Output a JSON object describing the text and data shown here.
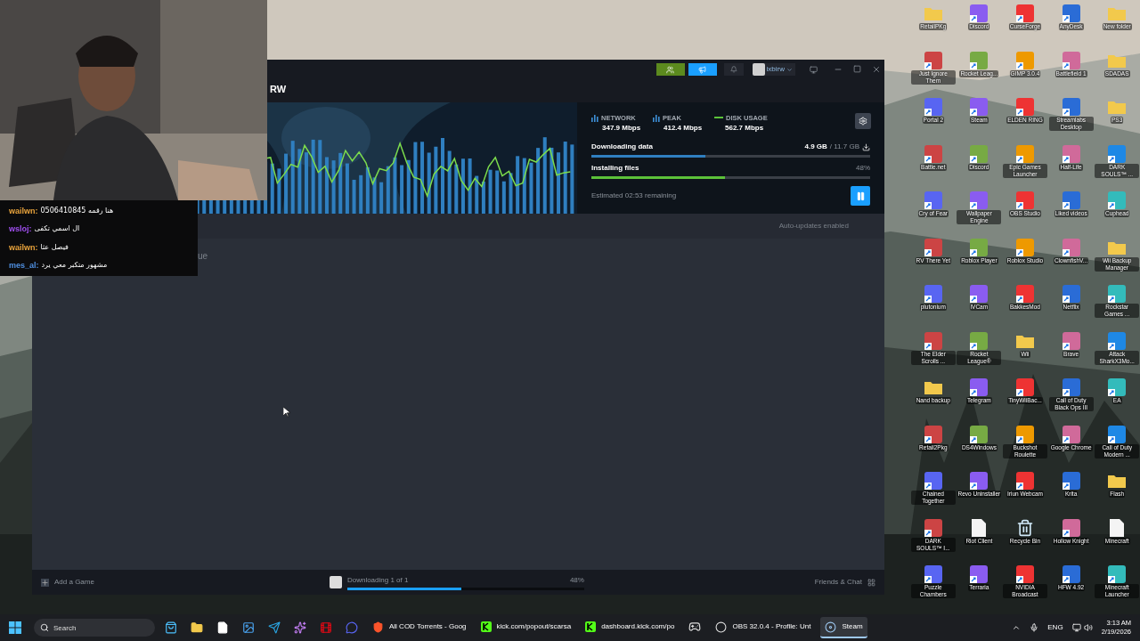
{
  "chat_overlay": {
    "messages": [
      {
        "user": "wailwn:",
        "color": "#e8a33c",
        "text": "هنا رقمه 0506410845"
      },
      {
        "user": "wsloj:",
        "color": "#a04ff0",
        "text": "ال اسمي تكفى"
      },
      {
        "user": "wailwn:",
        "color": "#e8a33c",
        "text": "فيصل عثا"
      },
      {
        "user": "mes_al:",
        "color": "#4f8fe0",
        "text": "مشهور متكبر معي يرد"
      }
    ]
  },
  "steam": {
    "title": "RW",
    "account": "ixbirw",
    "stats": [
      {
        "kind": "bars",
        "label": "NETWORK",
        "value": "347.9 Mbps"
      },
      {
        "kind": "bars",
        "label": "PEAK",
        "value": "412.4 Mbps"
      },
      {
        "kind": "line",
        "label": "DISK USAGE",
        "value": "562.7 Mbps"
      }
    ],
    "downloading": {
      "label": "Downloading data",
      "done": "4.9 GB",
      "total": "/ 11.7 GB",
      "level": 0.41
    },
    "installing": {
      "label": "Installing files",
      "percent": "48%",
      "level": 0.48
    },
    "estimate": "Estimated 02:53 remaining",
    "auto_updates": "Auto-updates enabled",
    "partial_text": "ue",
    "footer": {
      "add_game": "Add a Game",
      "download_status": "Downloading 1 of 1",
      "download_percent": "48%",
      "level": 0.48,
      "friends": "Friends & Chat"
    }
  },
  "desktop_icons": [
    {
      "label": "RetailPKg",
      "kind": "folder"
    },
    {
      "label": "Discord",
      "kind": "app"
    },
    {
      "label": "CurseForge",
      "kind": "app"
    },
    {
      "label": "AnyDesk",
      "kind": "app"
    },
    {
      "label": "New folder",
      "kind": "folder"
    },
    {
      "label": "Just Ignore Them",
      "kind": "app"
    },
    {
      "label": "Rocket Leag...",
      "kind": "app"
    },
    {
      "label": "GIMP 3.0.4",
      "kind": "app"
    },
    {
      "label": "Battlefield 1",
      "kind": "app"
    },
    {
      "label": "SDADAS",
      "kind": "folder"
    },
    {
      "label": "Portal 2",
      "kind": "app"
    },
    {
      "label": "Steam",
      "kind": "app"
    },
    {
      "label": "ELDEN RING",
      "kind": "app"
    },
    {
      "label": "Streamlabs Desktop",
      "kind": "app"
    },
    {
      "label": "PS3",
      "kind": "folder"
    },
    {
      "label": "Battle.net",
      "kind": "app"
    },
    {
      "label": "Discord",
      "kind": "app"
    },
    {
      "label": "Epic Games Launcher",
      "kind": "app"
    },
    {
      "label": "Half-Life",
      "kind": "app"
    },
    {
      "label": "DARK SOULS™ ...",
      "kind": "app"
    },
    {
      "label": "Cry of Fear",
      "kind": "app"
    },
    {
      "label": "Wallpaper Engine",
      "kind": "app"
    },
    {
      "label": "OBS Studio",
      "kind": "app"
    },
    {
      "label": "Liked videos",
      "kind": "app"
    },
    {
      "label": "Cuphead",
      "kind": "app"
    },
    {
      "label": "RV There Yet",
      "kind": "app"
    },
    {
      "label": "Roblox Player",
      "kind": "app"
    },
    {
      "label": "Roblox Studio",
      "kind": "app"
    },
    {
      "label": "ClownfishV...",
      "kind": "app"
    },
    {
      "label": "Wii Backup Manager",
      "kind": "folder"
    },
    {
      "label": "plutonium",
      "kind": "app"
    },
    {
      "label": "iVCam",
      "kind": "app"
    },
    {
      "label": "BakkesMod",
      "kind": "app"
    },
    {
      "label": "Netflix",
      "kind": "app"
    },
    {
      "label": "Rockstar Games ...",
      "kind": "app"
    },
    {
      "label": "The Elder Scrolls ...",
      "kind": "app"
    },
    {
      "label": "Rocket League®",
      "kind": "app"
    },
    {
      "label": "Wii",
      "kind": "folder"
    },
    {
      "label": "Brave",
      "kind": "app"
    },
    {
      "label": "Attack SharkX3Mo...",
      "kind": "app"
    },
    {
      "label": "Nand backup",
      "kind": "folder"
    },
    {
      "label": "Telegram",
      "kind": "app"
    },
    {
      "label": "TinyWiiBac...",
      "kind": "app"
    },
    {
      "label": "Call of Duty Black Ops III",
      "kind": "app"
    },
    {
      "label": "EA",
      "kind": "app"
    },
    {
      "label": "Retail2Pkg",
      "kind": "app"
    },
    {
      "label": "DS4Windows",
      "kind": "app"
    },
    {
      "label": "Buckshot Roulette",
      "kind": "app"
    },
    {
      "label": "Google Chrome",
      "kind": "app"
    },
    {
      "label": "Call of Duty Modern ...",
      "kind": "app"
    },
    {
      "label": "Chained Together",
      "kind": "app"
    },
    {
      "label": "Revo Uninstaller",
      "kind": "app"
    },
    {
      "label": "Iriun Webcam",
      "kind": "app"
    },
    {
      "label": "Krita",
      "kind": "app"
    },
    {
      "label": "Flash",
      "kind": "folder"
    },
    {
      "label": "DARK SOULS™ I...",
      "kind": "app"
    },
    {
      "label": "Riot Client",
      "kind": "file"
    },
    {
      "label": "Recycle Bin",
      "kind": "bin"
    },
    {
      "label": "Hollow Knight",
      "kind": "app"
    },
    {
      "label": "Minecraft",
      "kind": "file"
    },
    {
      "label": "Puzzle Chambers",
      "kind": "app"
    },
    {
      "label": "Terraria",
      "kind": "app"
    },
    {
      "label": "NVIDIA Broadcast",
      "kind": "app"
    },
    {
      "label": "HFW 4.92",
      "kind": "app"
    },
    {
      "label": "Minecraft Launcher",
      "kind": "app"
    }
  ],
  "taskbar": {
    "search_placeholder": "Search",
    "pinned": [
      {
        "kind": "store"
      },
      {
        "kind": "folder"
      },
      {
        "kind": "file"
      },
      {
        "kind": "photos"
      },
      {
        "kind": "telegram"
      },
      {
        "kind": "copilot"
      },
      {
        "kind": "netflix"
      },
      {
        "kind": "discord"
      }
    ],
    "tasks": [
      {
        "kind": "browser",
        "label": "All COD Torrents - Goog",
        "selected": false
      },
      {
        "kind": "kick",
        "label": "kick.com/popout/scarsa",
        "selected": false
      },
      {
        "kind": "kick",
        "label": "dashboard.kick.com/po",
        "selected": false
      },
      {
        "kind": "epic",
        "selected": false
      },
      {
        "kind": "obs",
        "label": "OBS 32.0.4 - Profile: Unt",
        "selected": false
      },
      {
        "kind": "steam",
        "label": "Steam",
        "selected": true
      }
    ],
    "language": "ENG",
    "time": "3:13 AM",
    "date": "2/19/2026"
  }
}
